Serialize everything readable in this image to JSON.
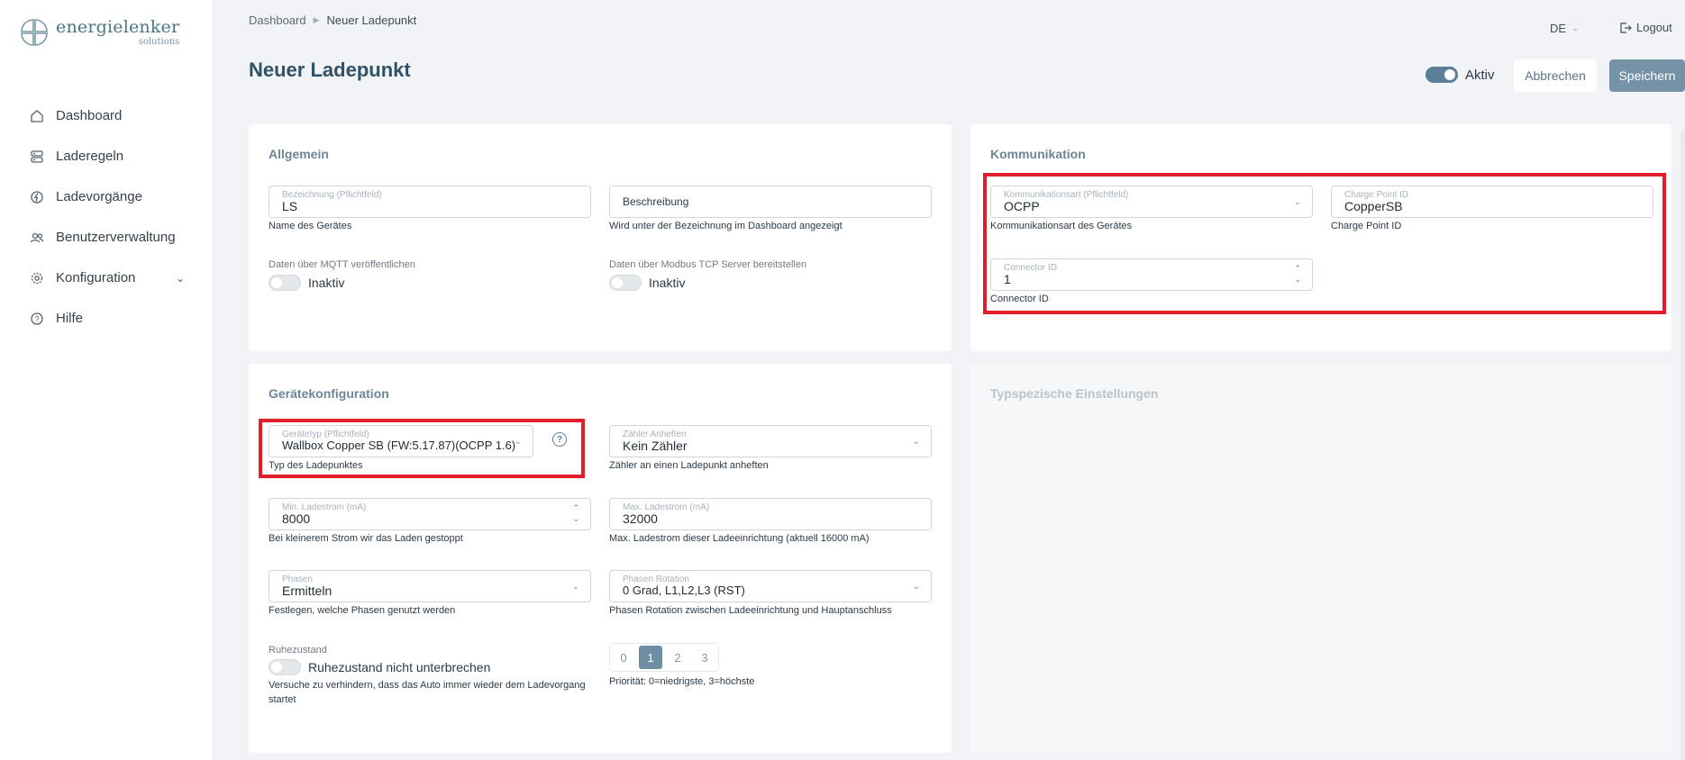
{
  "brand": {
    "name": "energielenker",
    "sub": "solutions",
    "colors": {
      "accent": "#5b7f96",
      "title": "#2f5266",
      "highlight": "#e11d2a"
    }
  },
  "sidebar": {
    "items": [
      {
        "label": "Dashboard",
        "icon": "home-icon"
      },
      {
        "label": "Laderegeln",
        "icon": "rules-icon"
      },
      {
        "label": "Ladevorgänge",
        "icon": "charging-icon"
      },
      {
        "label": "Benutzerverwaltung",
        "icon": "users-icon"
      },
      {
        "label": "Konfiguration",
        "icon": "gear-icon"
      },
      {
        "label": "Hilfe",
        "icon": "help-icon"
      }
    ]
  },
  "breadcrumb": {
    "root": "Dashboard",
    "current": "Neuer Ladepunkt"
  },
  "header": {
    "lang": "DE",
    "logout": "Logout"
  },
  "page": {
    "title": "Neuer Ladepunkt",
    "active_label": "Aktiv",
    "cancel": "Abbrechen",
    "save": "Speichern"
  },
  "allgemein": {
    "title": "Allgemein",
    "bezeichnung": {
      "label": "Bezeichnung (Pflichtfeld)",
      "value": "LS",
      "help": "Name des Gerätes"
    },
    "beschreibung": {
      "placeholder": "Beschreibung",
      "help": "Wird unter der Bezeichnung im Dashboard angezeigt"
    },
    "mqtt": {
      "label": "Daten über MQTT veröffentlichen",
      "state": "Inaktiv"
    },
    "modbus": {
      "label": "Daten über Modbus TCP Server bereitstellen",
      "state": "Inaktiv"
    }
  },
  "kommunikation": {
    "title": "Kommunikation",
    "art": {
      "label": "Kommunikationsart (Pflichtfeld)",
      "value": "OCPP",
      "help": "Kommunikationsart des Gerätes"
    },
    "chargepoint": {
      "label": "Charge Point ID",
      "value": "CopperSB",
      "help": "Charge Point ID"
    },
    "connector": {
      "label": "Connector ID",
      "value": "1",
      "help": "Connector ID"
    }
  },
  "geraet": {
    "title": "Gerätekonfiguration",
    "typ": {
      "label": "Gerätetyp (Pflichtfeld)",
      "value": "Wallbox Copper SB (FW:5.17.87)(OCPP 1.6)",
      "help": "Typ des Ladepunktes"
    },
    "zaehler": {
      "label": "Zähler Anheften",
      "value": "Kein Zähler",
      "help": "Zähler an einen Ladepunkt anheften"
    },
    "min": {
      "label": "Min. Ladestrom (mA)",
      "value": "8000",
      "help": "Bei kleinerem Strom wir das Laden gestoppt"
    },
    "max": {
      "label": "Max. Ladestrom (mA)",
      "value": "32000",
      "help": "Max. Ladestrom dieser Ladeeinrichtung (aktuell 16000 mA)"
    },
    "phasen": {
      "label": "Phasen",
      "value": "Ermitteln",
      "help": "Festlegen, welche Phasen genutzt werden"
    },
    "rotation": {
      "label": "Phasen Rotation",
      "value": "0 Grad, L1,L2,L3 (RST)",
      "help": "Phasen Rotation zwischen Ladeeinrichtung und Hauptanschluss"
    },
    "ruhe": {
      "label": "Ruhezustand",
      "toggle": "Ruhezustand nicht unterbrechen",
      "help1": "Versuche zu verhindern, dass das Auto immer wieder dem Ladevorgang",
      "help2": "startet"
    },
    "prio": {
      "options": [
        "0",
        "1",
        "2",
        "3"
      ],
      "selected": "1",
      "help": "Priorität: 0=niedrigste, 3=höchste"
    }
  },
  "typ_einstellungen": {
    "title": "Typspezische Einstellungen"
  }
}
